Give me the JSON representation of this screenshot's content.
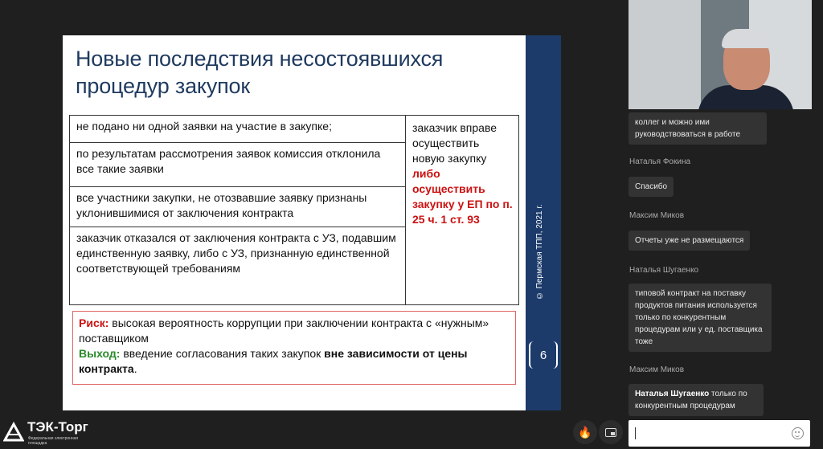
{
  "slide": {
    "title_line1": "Новые последствия несостоявшихся",
    "title_line2": "процедур закупок",
    "rows": [
      "не подано ни одной заявки на участие в закупке;",
      "по результатам рассмотрения заявок комиссия отклонила все такие заявки",
      "все участники закупки, не отозвавшие заявку признаны уклонившимися от заключения контракта",
      "заказчик отказался от заключения контракта с УЗ, подавшим единственную заявку, либо с УЗ, признанную единственной соответствующей требованиям"
    ],
    "right_plain": "заказчик вправе осуществить новую закупку",
    "right_red": "либо осуществить закупку у ЕП по п. 25 ч. 1 ст. 93",
    "risk_label": "Риск:",
    "risk_text": "высокая вероятность коррупции при заключении контракта с «нужным» поставщиком",
    "exit_label": "Выход:",
    "exit_text": "введение согласования таких закупок",
    "exit_bold": "вне зависимости от цены контракта",
    "exit_end": ".",
    "band_text": "© Пермская ТПП, 2021 г.",
    "page_number": "6"
  },
  "chat": {
    "msg0": "коллег и можно ими руководствоваться в работе",
    "name1": "Наталья Фокина",
    "msg1": "Спасибо",
    "name2": "Максим Миков",
    "msg2": "Отчеты уже не размещаются",
    "name3": "Наталья Шугаенко",
    "msg3": "типовой контракт на поставку продуктов питания используется только по конкурентным процедурам или у ед. поставщика тоже",
    "name4": "Максим Миков",
    "msg4_mention": "Наталья Шугаенко",
    "msg4_text": " только по конкурентным процедурам"
  },
  "logo": {
    "name": "ТЭК-Торг",
    "subtitle": "Федеральная электронная площадка"
  },
  "icons": {
    "fire": "fire-icon",
    "pip": "picture-in-picture-icon",
    "emoji": "smile-icon"
  }
}
